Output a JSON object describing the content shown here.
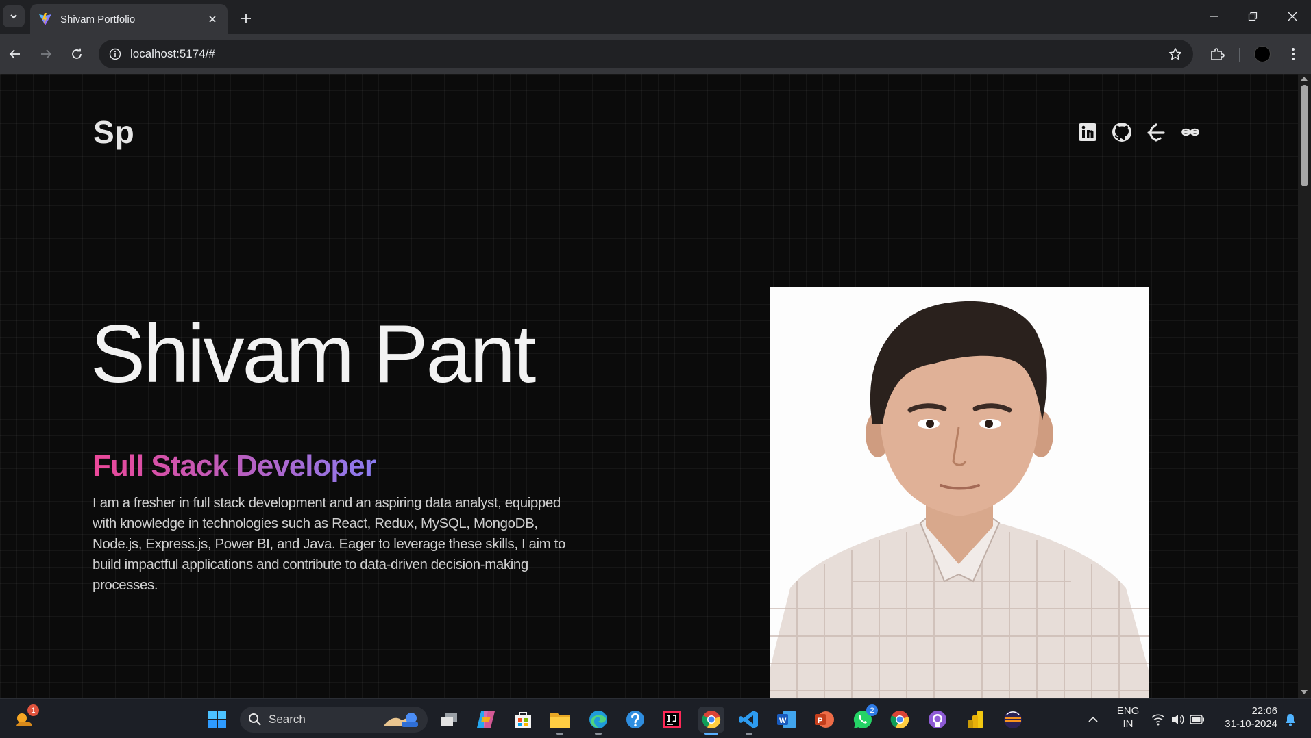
{
  "browser": {
    "tab_title": "Shivam Portfolio",
    "url": "localhost:5174/#"
  },
  "page": {
    "logo": "Sp",
    "social_icons": [
      "linkedin-icon",
      "github-icon",
      "geeksforgeeks-icon",
      "leetcode-icon"
    ],
    "name": "Shivam Pant",
    "role": "Full Stack Developer",
    "description": "I am a fresher in full stack development and an aspiring data analyst, equipped with knowledge in technologies such as React, Redux, MySQL, MongoDB, Node.js, Express.js, Power BI, and Java. Eager to leverage these skills, I aim to build impactful applications and contribute to data-driven decision-making processes.",
    "role_gradient": [
      "#ec4899",
      "#8b7cf0"
    ]
  },
  "taskbar": {
    "search_label": "Search",
    "widgets_badge": "1",
    "whatsapp_badge": "2",
    "language": "ENG",
    "region": "IN",
    "time": "22:06",
    "date": "31-10-2024",
    "apps": [
      "widgets-icon",
      "windows-start-icon",
      "search-icon",
      "task-view-icon",
      "copilot-icon",
      "microsoft-store-icon",
      "file-explorer-icon",
      "edge-icon",
      "help-icon",
      "intellij-icon",
      "chrome-icon",
      "vscode-icon",
      "word-icon",
      "powerpoint-icon",
      "whatsapp-icon",
      "chrome-icon",
      "github-desktop-icon",
      "power-bi-icon",
      "eclipse-icon"
    ]
  }
}
